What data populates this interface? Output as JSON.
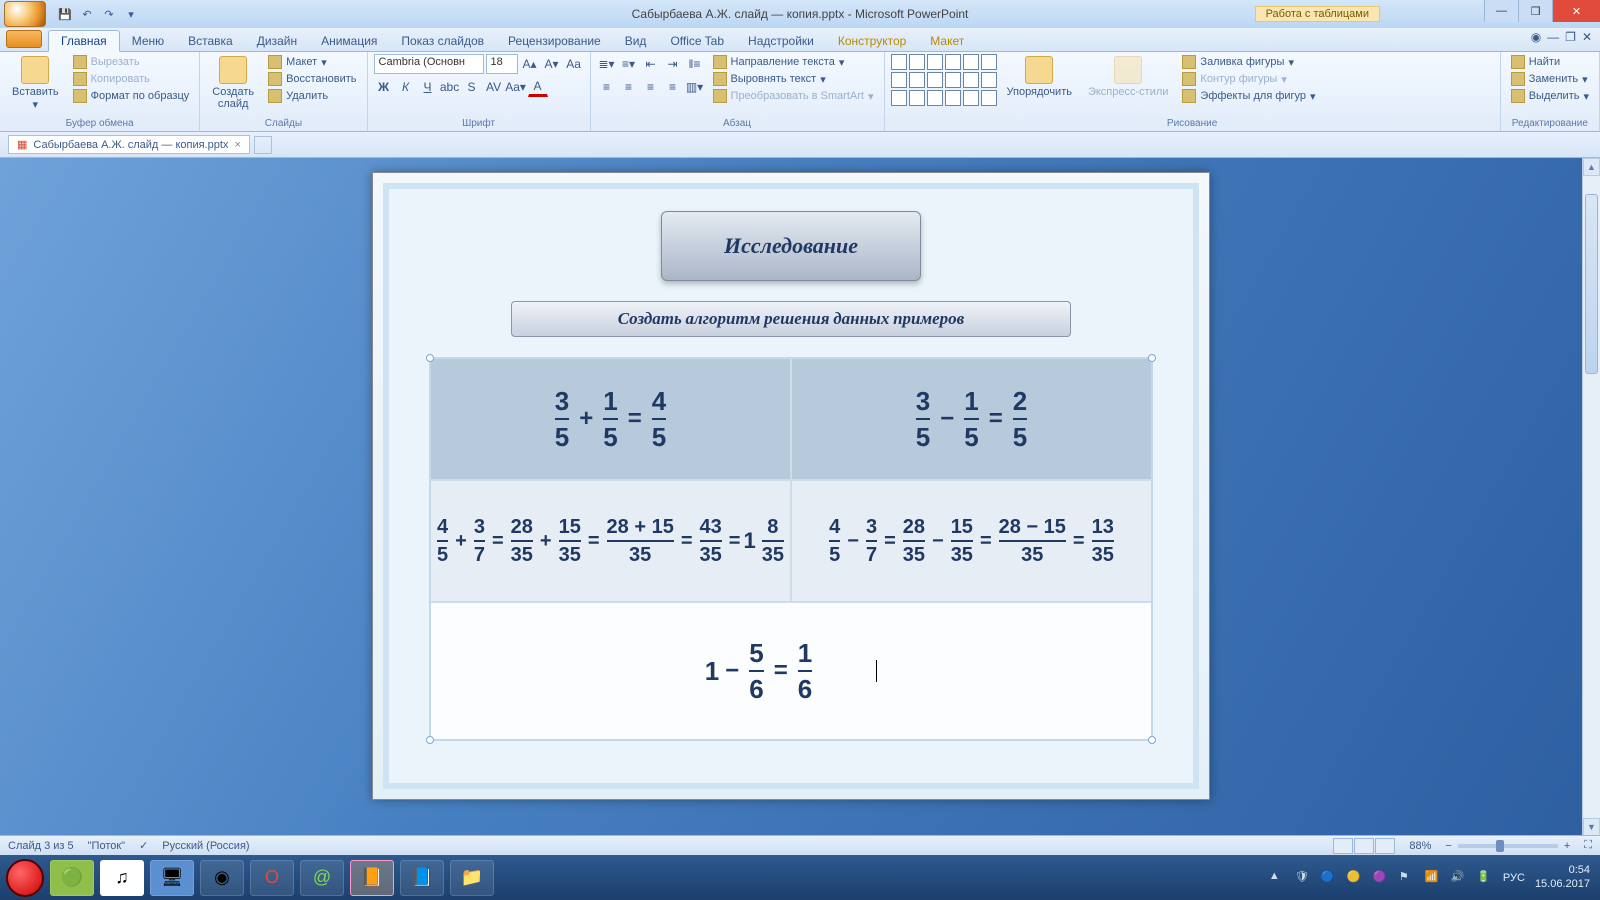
{
  "titlebar": {
    "doc_title": "Сабырбаева А.Ж. слайд — копия.pptx - Microsoft PowerPoint",
    "table_tools": "Работа с таблицами"
  },
  "tabs": {
    "t0": "Главная",
    "t1": "Меню",
    "t2": "Вставка",
    "t3": "Дизайн",
    "t4": "Анимация",
    "t5": "Показ слайдов",
    "t6": "Рецензирование",
    "t7": "Вид",
    "t8": "Office Tab",
    "t9": "Надстройки",
    "t10": "Конструктор",
    "t11": "Макет"
  },
  "ribbon": {
    "paste": "Вставить",
    "cut": "Вырезать",
    "copy": "Копировать",
    "format_painter": "Формат по образцу",
    "clipboard_label": "Буфер обмена",
    "new_slide": "Создать\nслайд",
    "layout": "Макет",
    "reset": "Восстановить",
    "delete": "Удалить",
    "slides_label": "Слайды",
    "font_name": "Cambria (Основн",
    "font_size": "18",
    "font_label": "Шрифт",
    "para_label": "Абзац",
    "text_dir": "Направление текста",
    "align_text": "Выровнять текст",
    "to_smart": "Преобразовать в SmartArt",
    "arrange": "Упорядочить",
    "quick_styles": "Экспресс-стили",
    "shape_fill": "Заливка фигуры",
    "shape_outline": "Контур фигуры",
    "shape_fx": "Эффекты для фигур",
    "drawing_label": "Рисование",
    "find": "Найти",
    "replace": "Заменить",
    "select": "Выделить",
    "editing_label": "Редактирование"
  },
  "doctab": {
    "name": "Сабырбаева А.Ж. слайд — копия.pptx"
  },
  "slide": {
    "title": "Исследование",
    "subtitle": "Создать алгоритм решения данных примеров",
    "r1c1": {
      "a_n": "3",
      "a_d": "5",
      "b_n": "1",
      "b_d": "5",
      "r_n": "4",
      "r_d": "5",
      "op": "+"
    },
    "r1c2": {
      "a_n": "3",
      "a_d": "5",
      "b_n": "1",
      "b_d": "5",
      "r_n": "2",
      "r_d": "5",
      "op": "−"
    },
    "r2c1": {
      "a_n": "4",
      "a_d": "5",
      "b_n": "3",
      "b_d": "7",
      "c_n": "28",
      "c_d": "35",
      "d_n": "15",
      "d_d": "35",
      "sum": "28 + 15",
      "sum_d": "35",
      "e_n": "43",
      "e_d": "35",
      "w": "1",
      "f_n": "8",
      "f_d": "35",
      "op": "+"
    },
    "r2c2": {
      "a_n": "4",
      "a_d": "5",
      "b_n": "3",
      "b_d": "7",
      "c_n": "28",
      "c_d": "35",
      "d_n": "15",
      "d_d": "35",
      "diff": "28 − 15",
      "diff_d": "35",
      "e_n": "13",
      "e_d": "35",
      "op": "−"
    },
    "r3": {
      "w": "1",
      "a_n": "5",
      "a_d": "6",
      "r_n": "1",
      "r_d": "6",
      "op": "−"
    }
  },
  "status": {
    "slide_info": "Слайд 3 из 5",
    "theme": "\"Поток\"",
    "lang": "Русский (Россия)",
    "zoom": "88%"
  },
  "tray": {
    "lang": "РУС",
    "time": "0:54",
    "date": "15.06.2017"
  }
}
